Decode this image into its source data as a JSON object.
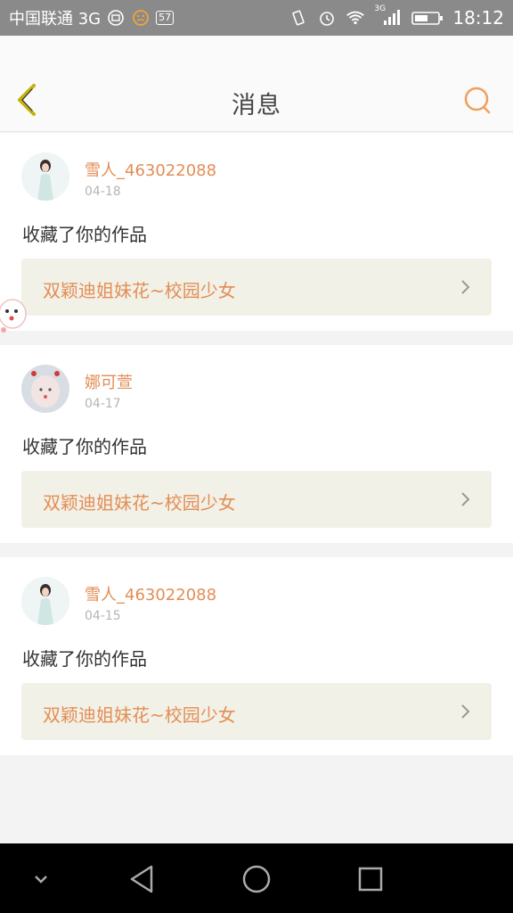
{
  "status_bar": {
    "carrier": "中国联通 3G",
    "badge": "57",
    "net_label": "3G",
    "time": "18:12"
  },
  "header": {
    "title": "消息"
  },
  "messages": [
    {
      "username": "雪人_463022088",
      "date": "04-18",
      "action": "收藏了你的作品",
      "work_title": "双颖迪姐妹花~校园少女"
    },
    {
      "username": "娜可萱",
      "date": "04-17",
      "action": "收藏了你的作品",
      "work_title": "双颖迪姐妹花~校园少女"
    },
    {
      "username": "雪人_463022088",
      "date": "04-15",
      "action": "收藏了你的作品",
      "work_title": "双颖迪姐妹花~校园少女"
    }
  ],
  "colors": {
    "accent": "#e38d55",
    "back_icon": "#c6b10b",
    "work_bg": "#f2f1e7"
  },
  "icons": {
    "back": "back-arrow-icon",
    "search": "search-icon",
    "chevron": "chevron-right-icon",
    "nav_collapse": "chevron-down-icon",
    "nav_back": "triangle-back-icon",
    "nav_home": "circle-home-icon",
    "nav_recent": "square-recent-icon"
  }
}
